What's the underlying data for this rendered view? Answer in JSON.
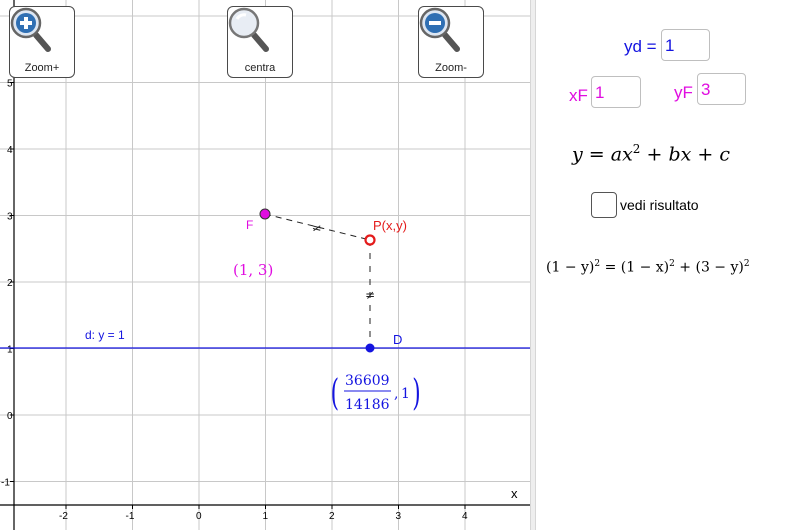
{
  "toolbar": {
    "zoom_in_label": "Zoom+",
    "center_label": "centra",
    "zoom_out_label": "Zoom-"
  },
  "graph": {
    "x_axis_label": "x",
    "x_ticks": [
      "-2",
      "-1",
      "0",
      "1",
      "2",
      "3",
      "4"
    ],
    "y_ticks": [
      "5",
      "4",
      "3",
      "2",
      "1",
      "0",
      "-1"
    ],
    "focus_label": "F",
    "focus_coords": "(1, 3)",
    "point_label": "P(x,y)",
    "directrix_point_label": "D",
    "directrix_label": "d: y = 1",
    "directrix_x_numerator": "36609",
    "directrix_x_denominator": "14186",
    "directrix_y": "1",
    "equal_mark": "≠",
    "colors": {
      "focus": "#e00de0",
      "point": "#e41b1b",
      "line": "#1414e0",
      "grid": "#c8c8c8"
    }
  },
  "algebra": {
    "yd_label": "yd =",
    "yd_value": "1",
    "xf_label": "xF",
    "xf_value": "1",
    "yf_label": "yF",
    "yf_value": "3",
    "formula_lhs": "y",
    "formula_eq": "=",
    "formula_ax": "ax",
    "formula_sup2": "2",
    "formula_plus_bx": "+ bx + c",
    "checkbox_label": "vedi risultato",
    "equation": {
      "left": "(1 − y)",
      "left_exp": "2",
      "eq": "=",
      "mid": "(1 − x)",
      "mid_exp": "2",
      "plus": "+",
      "right": "(3 − y)",
      "right_exp": "2"
    }
  }
}
